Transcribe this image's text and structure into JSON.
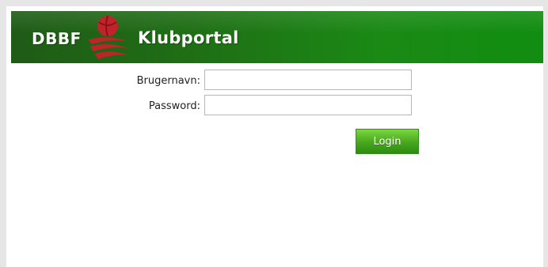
{
  "header": {
    "brand_left": "DBBF",
    "brand_right": "Klubportal",
    "logo_icon": "basketball-swoosh-icon"
  },
  "form": {
    "username_label": "Brugernavn:",
    "username_value": "",
    "username_placeholder": "",
    "password_label": "Password:",
    "password_value": "",
    "password_placeholder": "",
    "login_label": "Login"
  },
  "colors": {
    "header_green": "#1a7a15",
    "button_green": "#4caa20",
    "logo_red": "#c0242a"
  }
}
